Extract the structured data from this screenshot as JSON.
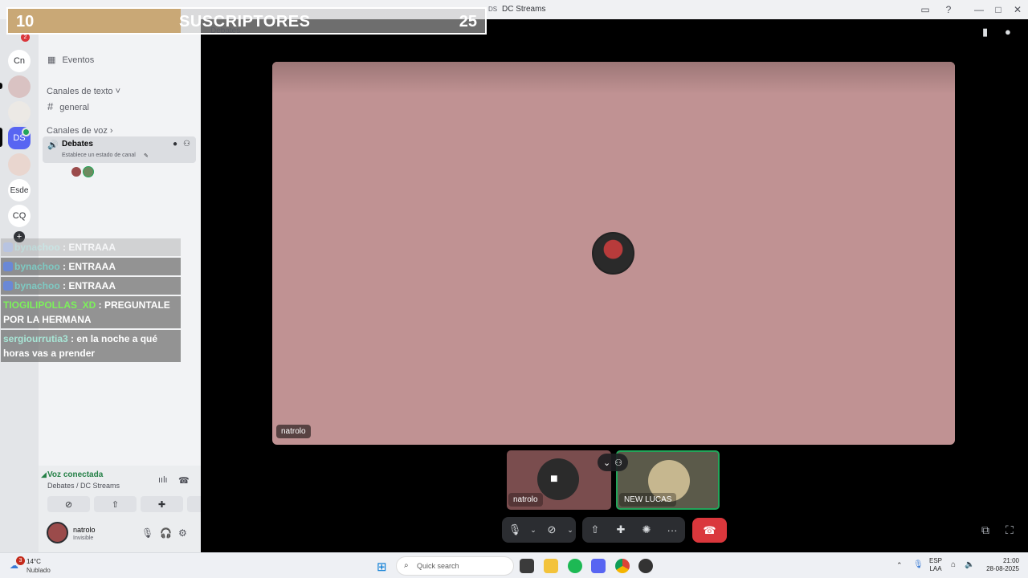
{
  "window": {
    "title": "DC Streams",
    "ds_tag": "DS"
  },
  "overlay": {
    "left_count": "10",
    "title": "SUSCRIPTORES",
    "right_count": "25",
    "ghost_text": "Debates"
  },
  "rail": {
    "servers": [
      "Cn",
      "DS",
      "Esde",
      "CQ"
    ],
    "badge": "2",
    "add": "+"
  },
  "sidebar": {
    "events": "Eventos",
    "text_category": "Canales de texto",
    "text_channel": "general",
    "voice_category": "Canales de voz",
    "voice_channel": "Debates",
    "voice_channel_status": "Establece un estado de canal"
  },
  "chat": [
    {
      "user": "bynachoo",
      "text": " : ENTRAAA",
      "faded": true
    },
    {
      "user": "bynachoo",
      "text": " : ENTRAAA"
    },
    {
      "user": "bynachoo",
      "text": " : ENTRAAA"
    },
    {
      "user": "TIOGILIPOLLAS_XD",
      "text": " : PREGUNTALE POR LA HERMANA"
    },
    {
      "user": "sergiourrutia3",
      "text": " : en la noche a qué horas vas a prender"
    }
  ],
  "voice_panel": {
    "status": "Voz conectada",
    "location": "Debates / DC Streams"
  },
  "user": {
    "name": "natrolo",
    "status": "Invisible"
  },
  "stage": {
    "main_name": "natrolo",
    "tiles": [
      {
        "name": "natrolo"
      },
      {
        "name": "NEW LUCAS"
      }
    ]
  },
  "taskbar": {
    "weather_temp": "14°C",
    "weather_desc": "Nublado",
    "weather_badge": "3",
    "search_placeholder": "Quick search",
    "lang": "ESP",
    "lang_sub": "LAA",
    "time": "21:00",
    "date": "28-08-2025"
  },
  "colors": {
    "accent": "#5865f2",
    "hangup": "#da373c",
    "connected": "#23a55a",
    "stage_bg": "#c09293"
  }
}
